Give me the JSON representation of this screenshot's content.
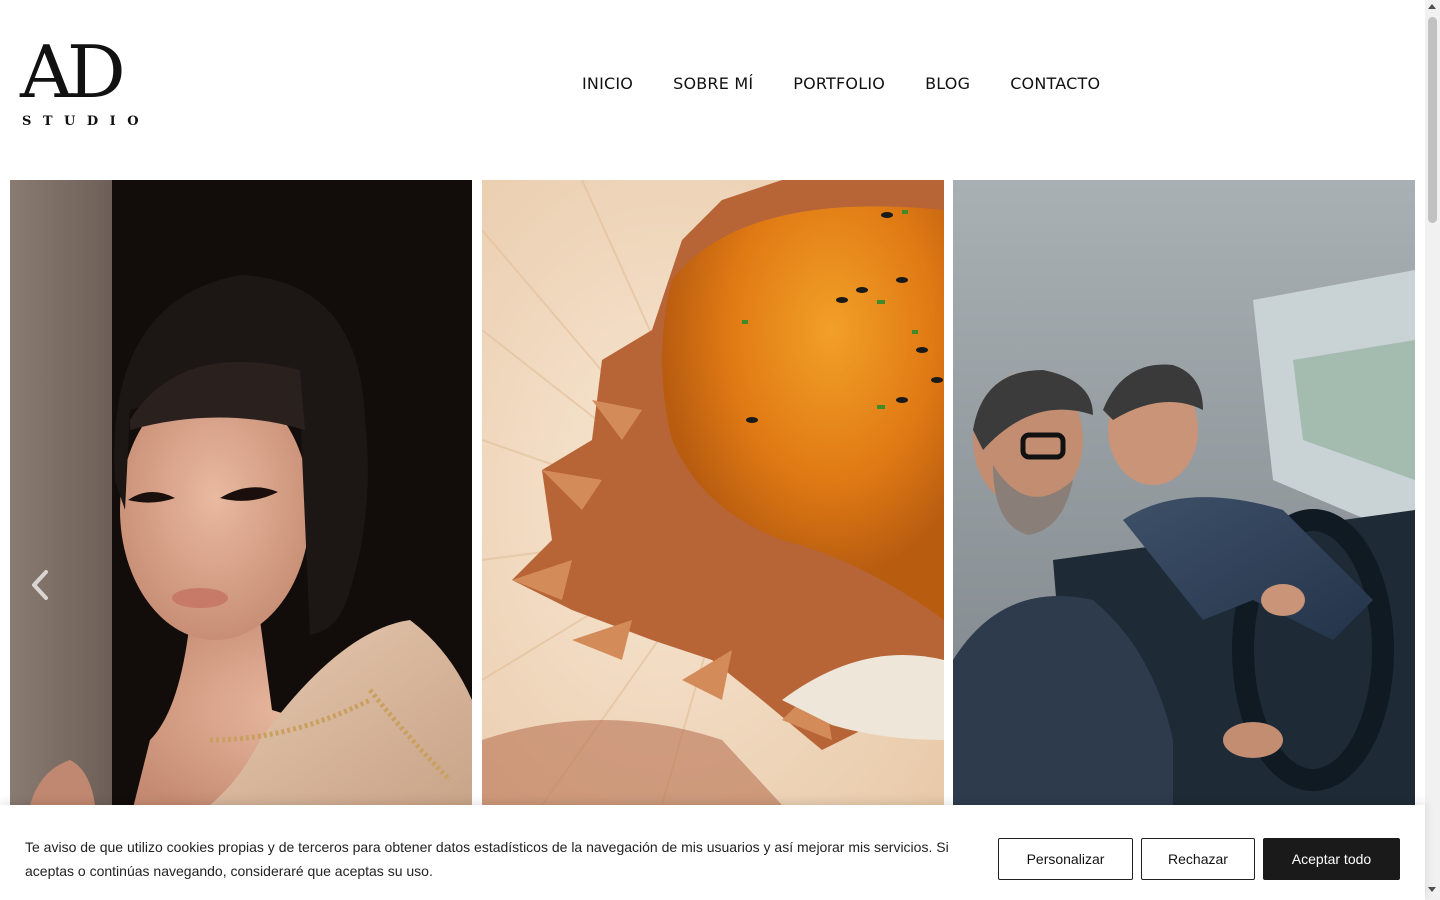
{
  "brand": {
    "logo_main": "AD",
    "logo_sub": "STUDIO"
  },
  "nav": {
    "items": [
      {
        "label": "INICIO"
      },
      {
        "label": "SOBRE MÍ"
      },
      {
        "label": "PORTFOLIO"
      },
      {
        "label": "BLOG"
      },
      {
        "label": "CONTACTO"
      }
    ]
  },
  "gallery": {
    "slides": [
      {
        "icon": "portrait-photo"
      },
      {
        "icon": "food-photo"
      },
      {
        "icon": "car-photo"
      }
    ],
    "prev_icon": "chevron-left-icon"
  },
  "cookie_banner": {
    "text": "Te aviso de que utilizo cookies propias y de terceros para obtener datos estadísticos de la navegación de mis usuarios y así mejorar mis servicios. Si aceptas o continúas navegando, consideraré que aceptas su uso.",
    "customize_label": "Personalizar",
    "reject_label": "Rechazar",
    "accept_label": "Aceptar todo"
  },
  "colors": {
    "text": "#111111",
    "accept_bg": "#1a1a1a",
    "background": "#ffffff"
  }
}
